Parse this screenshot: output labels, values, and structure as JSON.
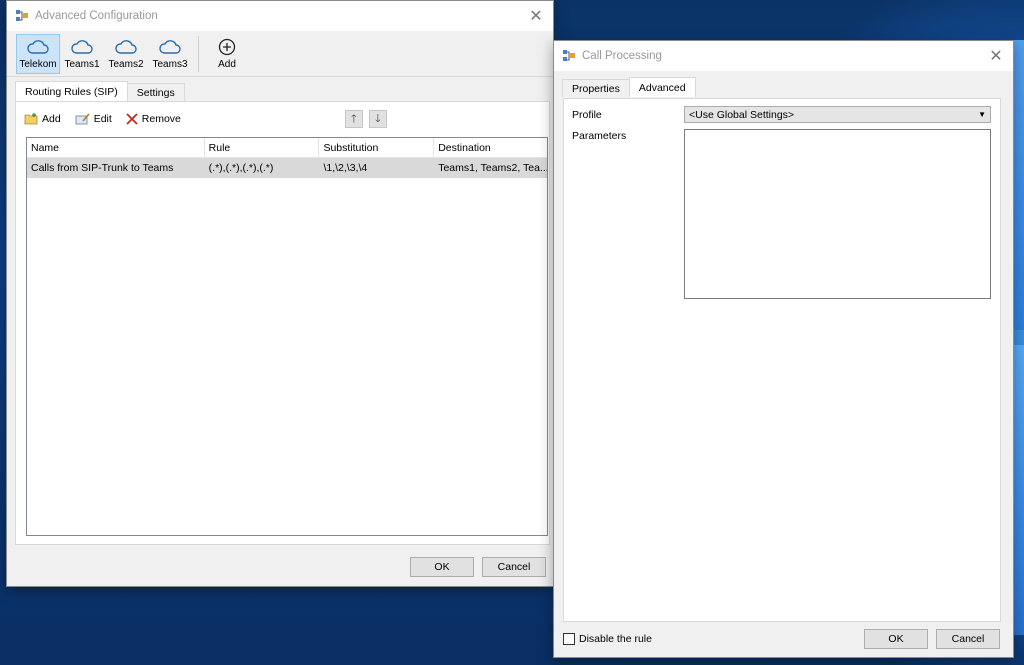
{
  "advanced_window": {
    "title": "Advanced Configuration",
    "ribbon": [
      {
        "label": "Telekom",
        "icon": "cloud-icon",
        "active": true
      },
      {
        "label": "Teams1",
        "icon": "cloud-icon"
      },
      {
        "label": "Teams2",
        "icon": "cloud-icon"
      },
      {
        "label": "Teams3",
        "icon": "cloud-icon"
      },
      {
        "label": "Add",
        "icon": "plus-circle-icon"
      }
    ],
    "tabs": [
      "Routing Rules (SIP)",
      "Settings"
    ],
    "toolbar": {
      "add": "Add",
      "edit": "Edit",
      "remove": "Remove"
    },
    "table": {
      "columns": [
        "Name",
        "Rule",
        "Substitution",
        "Destination"
      ],
      "rows": [
        [
          "Calls from SIP-Trunk to Teams",
          "(.*),(.*),(.*),(.*)",
          "\\1,\\2,\\3,\\4",
          "Teams1, Teams2, Tea..."
        ]
      ]
    },
    "ok": "OK",
    "cancel": "Cancel"
  },
  "call_processing_window": {
    "title": "Call Processing",
    "tabs": [
      "Properties",
      "Advanced"
    ],
    "profile_label": "Profile",
    "profile_value": "<Use Global Settings>",
    "parameters_label": "Parameters",
    "disable_rule": "Disable the rule",
    "ok": "OK",
    "cancel": "Cancel"
  },
  "colors": {
    "selection": "#cce4f7",
    "row_highlight": "#d9d9d9",
    "remove_x": "#c42b1c"
  }
}
